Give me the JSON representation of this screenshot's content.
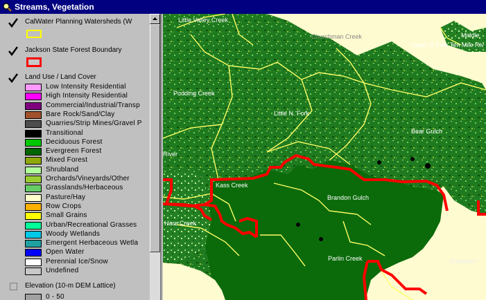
{
  "window": {
    "title": "Streams, Vegetation"
  },
  "legend": {
    "themes": [
      {
        "name": "CalWater Planning Watersheds (W",
        "checked": true
      },
      {
        "name": "Jackson State Forest Boundary",
        "checked": true
      },
      {
        "name": "Land Use / Land Cover",
        "checked": true
      },
      {
        "name": "Elevation (10-m DEM Lattice)",
        "checked": false
      }
    ],
    "landcover": [
      {
        "label": "Low Intensity Residential",
        "color": "#ff99ff"
      },
      {
        "label": "High Intensity Residential",
        "color": "#ff00ff"
      },
      {
        "label": "Commercial/Industrial/Transp",
        "color": "#7f007f"
      },
      {
        "label": "Bare Rock/Sand/Clay",
        "color": "#a0522d"
      },
      {
        "label": "Quarries/Strip Mines/Gravel P",
        "color": "#4d4d4d"
      },
      {
        "label": "Transitional",
        "color": "#000000"
      },
      {
        "label": "Deciduous Forest",
        "color": "#00c800"
      },
      {
        "label": "Evergreen Forest",
        "color": "#006400"
      },
      {
        "label": "Mixed Forest",
        "color": "#8ea80a"
      },
      {
        "label": "Shrubland",
        "color": "#b0ff9a"
      },
      {
        "label": "Orchards/Vineyards/Other",
        "color": "#9acd32"
      },
      {
        "label": "Grasslands/Herbaceous",
        "color": "#66cc66"
      },
      {
        "label": "Pasture/Hay",
        "color": "#ffffcc"
      },
      {
        "label": "Row Crops",
        "color": "#ffb000"
      },
      {
        "label": "Small Grains",
        "color": "#ffff00"
      },
      {
        "label": "Urban/Recreational Grasses",
        "color": "#00ff99"
      },
      {
        "label": "Woody Wetlands",
        "color": "#00c8e6"
      },
      {
        "label": "Emergent Herbaceous Wetla",
        "color": "#1ea0a0"
      },
      {
        "label": "Open Water",
        "color": "#0000ff"
      },
      {
        "label": "Perennial Ice/Snow",
        "color": "#ffffff"
      },
      {
        "label": "Undefined",
        "color": "#c8c8c8"
      }
    ],
    "elevation_first": {
      "label": "0 - 50",
      "color": "#a0a0a0"
    }
  },
  "map": {
    "labels": {
      "little_valley_creek": "Little Valley Creek",
      "churchman_creek": "Churchman Creek",
      "middle": "Middle",
      "upper_s_fork": "Upper S Fork Ten Mile Riv",
      "pudding_creek": "Pudding Creek",
      "little_n_fork": "Little N. Fork",
      "bear_gulch": "Bear Gulch",
      "river": "River",
      "kass_creek": "Kass Creek",
      "brandon_gulch": "Brandon Gulch",
      "hare_creek": "Hare Creek",
      "parlin_creek": "Parlin Creek",
      "chamberlain": "Chamberl"
    },
    "colors": {
      "background": "#fffbd0",
      "forest": "#1f7a1f",
      "dark_forest": "#0b4d0b",
      "watershed": "#ffff66",
      "boundary": "#ff0000"
    }
  }
}
